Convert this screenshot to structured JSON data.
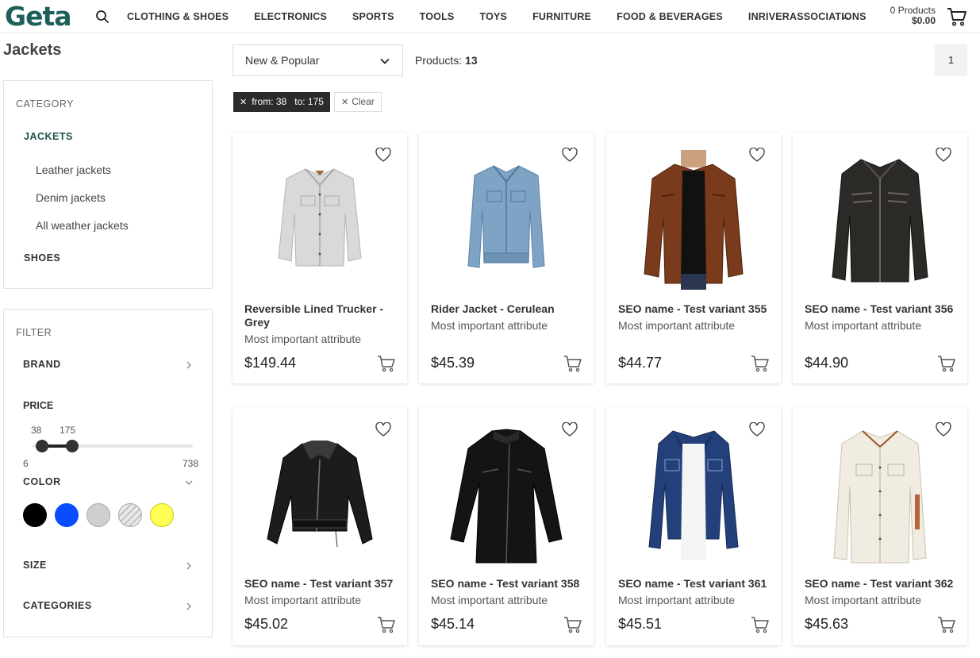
{
  "header": {
    "logo": "Geta",
    "nav": [
      "CLOTHING & SHOES",
      "ELECTRONICS",
      "SPORTS",
      "TOOLS",
      "TOYS",
      "FURNITURE",
      "FOOD & BEVERAGES",
      "INRIVERASSOCIATIONS"
    ],
    "more": "...",
    "cart_count": "0 Products",
    "cart_total": "$0.00",
    "icons": {
      "search": "search-icon",
      "cart": "cart-icon"
    }
  },
  "page": {
    "title": "Jackets"
  },
  "sidebar": {
    "category": {
      "heading": "CATEGORY",
      "current": "JACKETS",
      "subcategories": [
        "Leather jackets",
        "Denim jackets",
        "All weather jackets"
      ],
      "other": "SHOES"
    },
    "filter": {
      "heading": "FILTER",
      "brand": "BRAND",
      "price": {
        "label": "PRICE",
        "min": "6",
        "max": "738",
        "from": "38",
        "to": "175",
        "from_value": 38,
        "to_value": 175,
        "range_min": 6,
        "range_max": 738
      },
      "color": {
        "label": "COLOR",
        "swatches": [
          "#000000",
          "#0a4dff",
          "#cfcfcf",
          "striped-silver",
          "#ffff55"
        ]
      },
      "size": "SIZE",
      "categories": "CATEGORIES"
    }
  },
  "toolbar": {
    "sort": "New & Popular",
    "products_label": "Products:",
    "products_count": "13",
    "page": "1",
    "active_filter": "from: 38   to: 175",
    "clear": "Clear"
  },
  "products": [
    {
      "name": "Reversible Lined Trucker - Grey",
      "attribute": "Most important attribute",
      "price": "$149.44",
      "image": "grey-denim-jacket"
    },
    {
      "name": "Rider Jacket - Cerulean",
      "attribute": "Most important attribute",
      "price": "$45.39",
      "image": "light-blue-denim-jacket"
    },
    {
      "name": "SEO name - Test variant 355",
      "attribute": "Most important attribute",
      "price": "$44.77",
      "image": "brown-leather-jacket"
    },
    {
      "name": "SEO name - Test variant 356",
      "attribute": "Most important attribute",
      "price": "$44.90",
      "image": "black-distressed-leather-jacket"
    },
    {
      "name": "SEO name - Test variant 357",
      "attribute": "Most important attribute",
      "price": "$45.02",
      "image": "black-cropped-leather-jacket"
    },
    {
      "name": "SEO name - Test variant 358",
      "attribute": "Most important attribute",
      "price": "$45.14",
      "image": "black-zip-moto-jacket"
    },
    {
      "name": "SEO name - Test variant 361",
      "attribute": "Most important attribute",
      "price": "$45.51",
      "image": "dark-denim-jacket"
    },
    {
      "name": "SEO name - Test variant 362",
      "attribute": "Most important attribute",
      "price": "$45.63",
      "image": "cream-trucker-jacket"
    }
  ],
  "colors": {
    "brand": "#1f5f5b",
    "chip_dark": "#2b2b2b"
  }
}
